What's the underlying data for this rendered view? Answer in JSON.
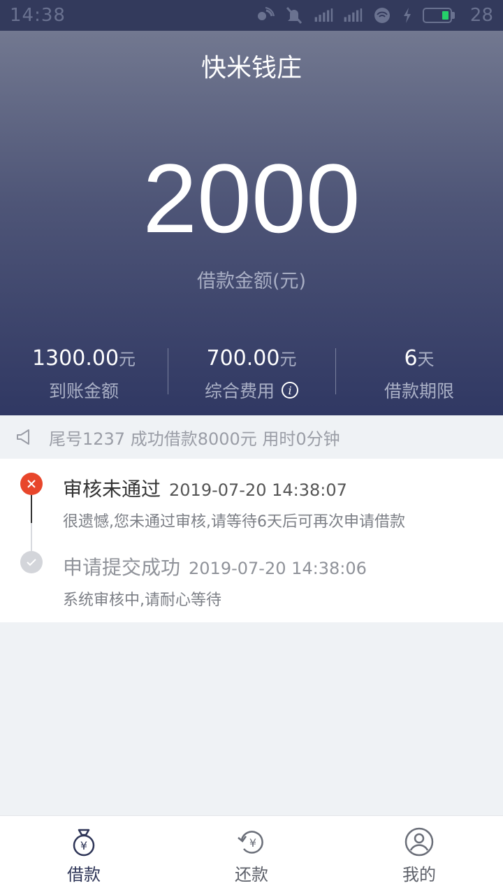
{
  "status_bar": {
    "time": "14:38",
    "battery_level": "28",
    "icons": [
      "signal-wave-icon",
      "mute-bell-icon",
      "signal-4g-icon",
      "signal-bars-icon",
      "wifi-icon",
      "charging-icon",
      "battery-icon"
    ],
    "battery_fill_fraction": 0.28,
    "colors": {
      "background": "#333a5c",
      "battery_fill": "#25d06a"
    }
  },
  "header": {
    "title": "快米钱庄"
  },
  "loan": {
    "amount": "2000",
    "amount_label": "借款金额(元)",
    "stats": [
      {
        "value": "1300.00",
        "unit": "元",
        "label": "到账金额",
        "has_info": false
      },
      {
        "value": "700.00",
        "unit": "元",
        "label": "综合费用",
        "has_info": true
      },
      {
        "value": "6",
        "unit": "天",
        "label": "借款期限",
        "has_info": false
      }
    ]
  },
  "notice": {
    "icon": "speaker-icon",
    "text": "尾号1237 成功借款8000元 用时0分钟"
  },
  "timeline": [
    {
      "status": "审核未通过",
      "time": "2019-07-20 14:38:07",
      "desc": "很遗憾,您未通过审核,请等待6天后可再次申请借款",
      "icon": "close-icon",
      "color": "#e8462b"
    },
    {
      "status": "申请提交成功",
      "time": "2019-07-20 14:38:06",
      "desc": "系统审核中,请耐心等待",
      "icon": "check-icon",
      "color": "#d3d5da"
    }
  ],
  "tabbar": {
    "tabs": [
      {
        "label": "借款",
        "icon": "money-bag-icon",
        "active": true
      },
      {
        "label": "还款",
        "icon": "repay-icon",
        "active": false
      },
      {
        "label": "我的",
        "icon": "user-icon",
        "active": false
      }
    ]
  }
}
